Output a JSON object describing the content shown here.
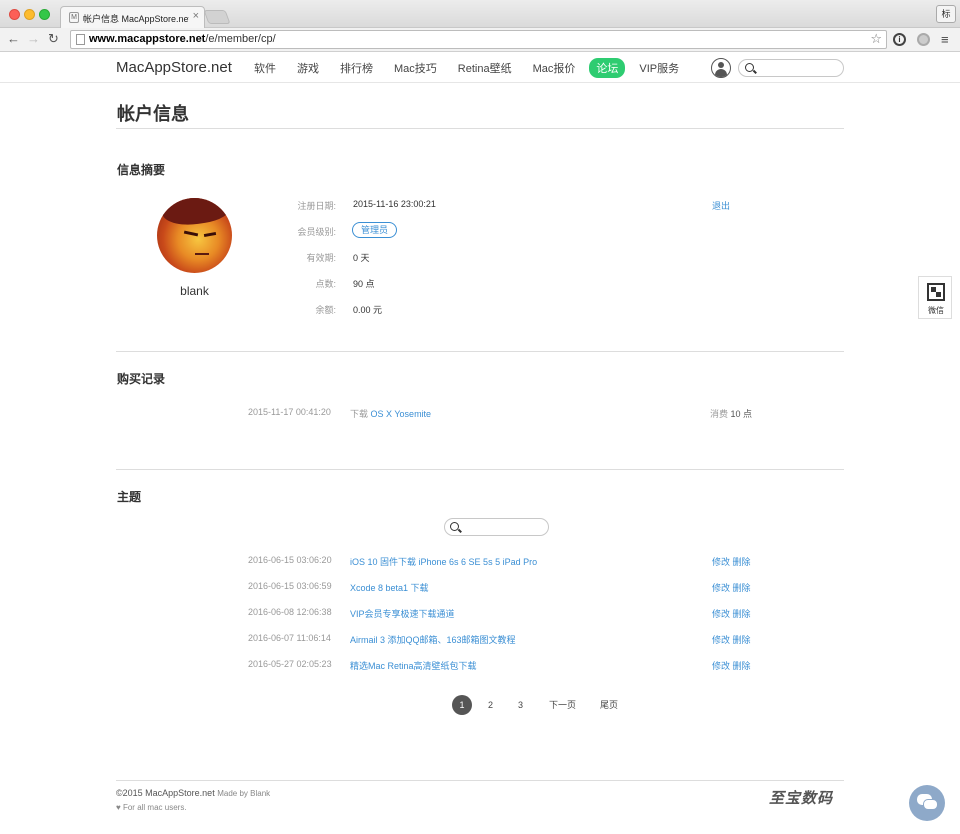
{
  "browser": {
    "tab_title": "帐户信息 MacAppStore.net",
    "tab_close": "×",
    "favicon": "M",
    "profile_label": "标",
    "url_domain": "www.macappstore.net",
    "url_path": "/e/member/cp/",
    "icons": [
      "back-icon",
      "forward-icon",
      "reload-icon",
      "star-icon",
      "info-icon",
      "extension-icon",
      "menu-icon"
    ]
  },
  "site": {
    "logo": "MacAppStore.net",
    "nav": [
      "软件",
      "游戏",
      "排行榜",
      "Mac技巧",
      "Retina壁纸",
      "Mac报价",
      "论坛",
      "VIP服务"
    ],
    "active_nav": "论坛",
    "accent_color": "#2ecc71",
    "link_color": "#3b8fd4"
  },
  "page": {
    "title": "帐户信息"
  },
  "summary": {
    "heading": "信息摘要",
    "username": "blank",
    "logout": "退出",
    "fields": [
      {
        "label": "注册日期:",
        "value": "2015-11-16 23:00:21"
      },
      {
        "label": "会员级别:",
        "value": "管理员"
      },
      {
        "label": "有效期:",
        "value": "0 天"
      },
      {
        "label": "点数:",
        "value": "90 点"
      },
      {
        "label": "余额:",
        "value": "0.00 元"
      }
    ]
  },
  "purchases": {
    "heading": "购买记录",
    "rows": [
      {
        "date": "2015-11-17 00:41:20",
        "prefix": "下载",
        "title": "OS X Yosemite",
        "cost_label": "消费",
        "cost_value": "10 点"
      }
    ]
  },
  "topics": {
    "heading": "主题",
    "edit_label": "修改",
    "delete_label": "删除",
    "rows": [
      {
        "date": "2016-06-15 03:06:20",
        "title": "iOS 10 固件下载 iPhone 6s 6 SE 5s 5 iPad Pro"
      },
      {
        "date": "2016-06-15 03:06:59",
        "title": "Xcode 8 beta1 下载"
      },
      {
        "date": "2016-06-08 12:06:38",
        "title": "VIP会员专享极速下载通道"
      },
      {
        "date": "2016-06-07 11:06:14",
        "title": "Airmail 3 添加QQ邮箱、163邮箱图文教程"
      },
      {
        "date": "2016-05-27 02:05:23",
        "title": "精选Mac Retina高清壁纸包下载"
      }
    ]
  },
  "pagination": {
    "pages": [
      "1",
      "2",
      "3"
    ],
    "current": "1",
    "next": "下一页",
    "last": "尾页"
  },
  "footer": {
    "copyright": "©2015 MacAppStore.net",
    "made_by": "Made by Blank",
    "note": "♥ For all mac users.",
    "watermark": "至宝数码"
  },
  "side": {
    "wechat_label": "微信"
  }
}
